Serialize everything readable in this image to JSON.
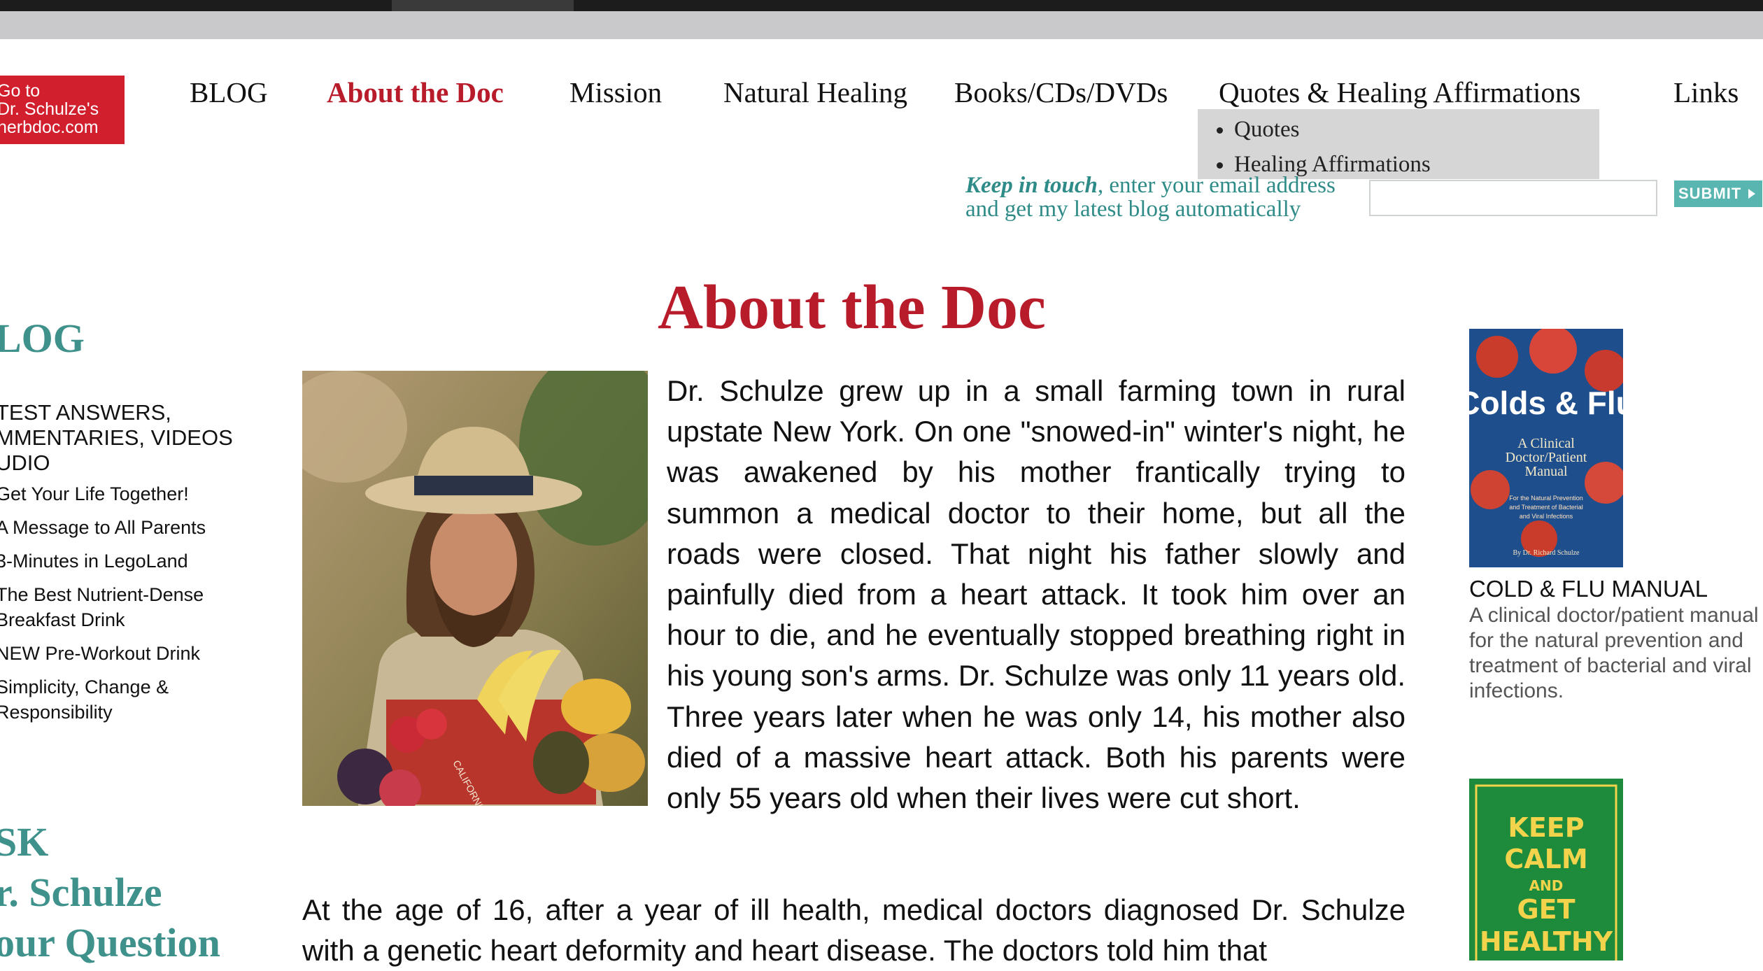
{
  "logo": {
    "line1": "Go to",
    "line2": "Dr. Schulze's",
    "line3": "herbdoc.com"
  },
  "nav": {
    "blog": "BLOG",
    "about": "About the Doc",
    "mission": "Mission",
    "natural_healing": "Natural Healing",
    "books": "Books/CDs/DVDs",
    "quotes": "Quotes & Healing Affirmations",
    "links": "Links"
  },
  "dropdown": {
    "items": [
      "Quotes",
      "Healing Affirmations"
    ]
  },
  "subscribe": {
    "keep": "Keep in touch",
    "line1_rest": ", enter your email address",
    "line2": "and get my latest blog automatically",
    "email_value": "",
    "submit_label": "SUBMIT"
  },
  "sidebar": {
    "blog_heading": "LOG",
    "sub": [
      "TEST ANSWERS,",
      "MMENTARIES, VIDEOS",
      "UDIO"
    ],
    "posts": [
      {
        "lines": [
          "Get Your Life Together!"
        ]
      },
      {
        "lines": [
          "A Message to All Parents"
        ]
      },
      {
        "lines": [
          "3-Minutes in LegoLand"
        ]
      },
      {
        "lines": [
          "The Best Nutrient-Dense",
          "Breakfast Drink"
        ]
      },
      {
        "lines": [
          "NEW Pre-Workout Drink"
        ]
      },
      {
        "lines": [
          "Simplicity, Change &",
          "Responsibility"
        ]
      }
    ],
    "ask": [
      "SK",
      "r. Schulze",
      "our Question"
    ]
  },
  "main": {
    "title": "About the Doc",
    "para1": "Dr. Schulze grew up in a small farming town in rural upstate New York. On one \"snowed-in\" winter's night, he was awakened by his mother frantically trying to summon a medical doctor to their home, but all the roads were closed. That night his father slowly and painfully died from a heart attack. It took him over an hour to die, and he eventually stopped breathing right in his young son's arms. Dr. Schulze was only 11 years old. Three years later when he was only 14, his mother also died of a massive heart attack. Both his parents were only 55 years old when their lives were cut short.",
    "para2": "At the age of 16, after a year of ill health, medical doctors diagnosed Dr. Schulze with a genetic heart deformity and heart disease. The doctors told him that"
  },
  "right": {
    "book_cover": {
      "title": "Colds & Flu",
      "sub1": "A Clinical",
      "sub2": "Doctor/Patient",
      "sub3": "Manual",
      "tag1": "For the Natural Prevention",
      "tag2": "and Treatment of Bacterial",
      "tag3": "and Viral Infections",
      "author": "By Dr. Richard Schulze"
    },
    "book_title": "COLD & FLU MANUAL",
    "book_desc": "A clinical doctor/patient manual for the natural prevention and treatment of bacterial and viral infections.",
    "poster": {
      "l1": "KEEP",
      "l2": "CALM",
      "l3": "AND",
      "l4": "GET",
      "l5": "HEALTHY"
    }
  },
  "photo": {
    "crate_text": "CALIFORNIA GROWN"
  },
  "colors": {
    "accent_red": "#b81c2a",
    "teal": "#3f918b",
    "logo_red": "#d21f2d",
    "submit_teal": "#59b5b0",
    "poster_green": "#1d8a3c"
  }
}
